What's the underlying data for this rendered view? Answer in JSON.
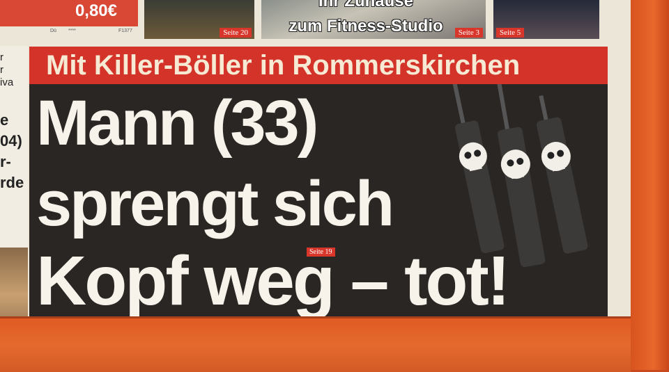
{
  "top_strip": {
    "price": "0,80€",
    "meta_left": "Dü",
    "meta_mid": "****",
    "meta_right": "F1377",
    "teasers": [
      {
        "page": "Seite 20"
      },
      {
        "title_line1": "Ihr Zuhause",
        "title_line2": "zum Fitness-Studio",
        "page": "Seite 3"
      },
      {
        "page": "Seite 5"
      }
    ]
  },
  "left_column": {
    "fragments": [
      "r",
      "r",
      "iva",
      "e",
      "04)",
      "r-",
      "rde",
      "Seite"
    ]
  },
  "main_story": {
    "rubric": "Mit Killer-Böller in Rommerskirchen",
    "headline_line1": "Mann (33)",
    "headline_line2": "sprengt sich",
    "headline_line3": "Kopf weg – tot!",
    "page_ref": "Seite 19",
    "illustration": "skull-firecrackers"
  },
  "colors": {
    "bild_red": "#d4332a",
    "paper": "#ece6d8",
    "box_frame_orange": "#e05b23"
  }
}
